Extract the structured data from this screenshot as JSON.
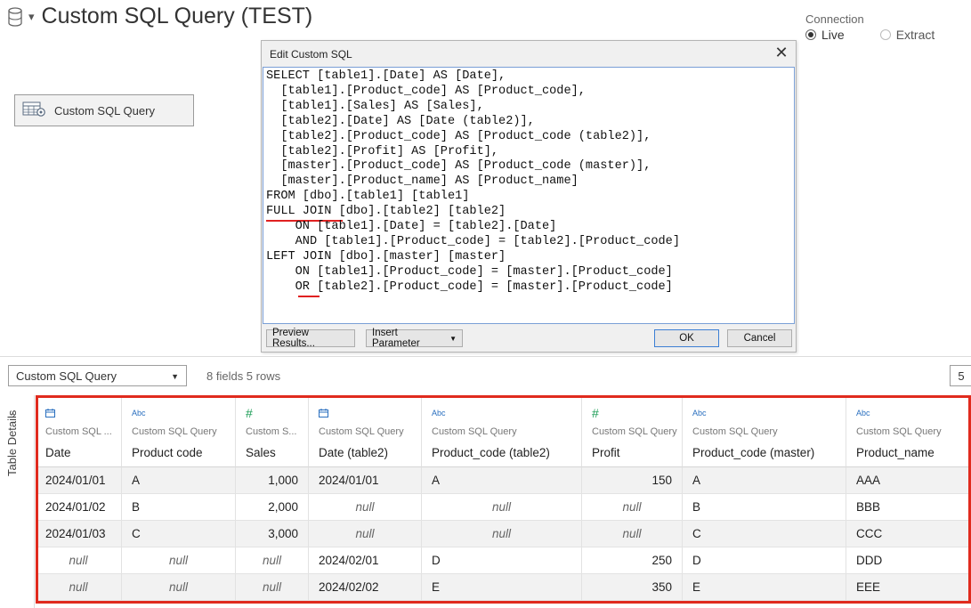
{
  "header": {
    "title": "Custom SQL Query (TEST)",
    "connection_label": "Connection",
    "live_label": "Live",
    "extract_label": "Extract"
  },
  "canvas": {
    "table_pill_label": "Custom SQL Query"
  },
  "dialog": {
    "title": "Edit Custom SQL",
    "close": "✕",
    "sql_lines": [
      "SELECT [table1].[Date] AS [Date],",
      "  [table1].[Product_code] AS [Product_code],",
      "  [table1].[Sales] AS [Sales],",
      "  [table2].[Date] AS [Date (table2)],",
      "  [table2].[Product_code] AS [Product_code (table2)],",
      "  [table2].[Profit] AS [Profit],",
      "  [master].[Product_code] AS [Product_code (master)],",
      "  [master].[Product_name] AS [Product_name]",
      "FROM [dbo].[table1] [table1]",
      "FULL JOIN [dbo].[table2] [table2]",
      "    ON [table1].[Date] = [table2].[Date]",
      "    AND [table1].[Product_code] = [table2].[Product_code]",
      "LEFT JOIN [dbo].[master] [master]",
      "    ON [table1].[Product_code] = [master].[Product_code]",
      "    OR [table2].[Product_code] = [master].[Product_code]"
    ],
    "preview_btn": "Preview Results...",
    "insert_param_btn": "Insert Parameter",
    "insert_param_caret": "▼",
    "ok_btn": "OK",
    "cancel_btn": "Cancel"
  },
  "toolbar": {
    "table_select": "Custom SQL Query",
    "select_caret": "▼",
    "fields_info": "8 fields 5 rows",
    "rows_value": "5"
  },
  "side": {
    "chevron": "›",
    "label": "Table Details"
  },
  "grid": {
    "columns": [
      {
        "type": "date",
        "icon": "calendar-icon",
        "source": "Custom SQL ...",
        "name": "Date"
      },
      {
        "type": "string",
        "icon": "Abc",
        "source": "Custom SQL Query",
        "name": "Product code"
      },
      {
        "type": "number",
        "icon": "#",
        "source": "Custom S...",
        "name": "Sales"
      },
      {
        "type": "date",
        "icon": "calendar-icon",
        "source": "Custom SQL Query",
        "name": "Date (table2)"
      },
      {
        "type": "string",
        "icon": "Abc",
        "source": "Custom SQL Query",
        "name": "Product_code (table2)"
      },
      {
        "type": "number",
        "icon": "#",
        "source": "Custom SQL Query",
        "name": "Profit"
      },
      {
        "type": "string",
        "icon": "Abc",
        "source": "Custom SQL Query",
        "name": "Product_code (master)"
      },
      {
        "type": "string",
        "icon": "Abc",
        "source": "Custom SQL Query",
        "name": "Product_name"
      }
    ],
    "rows": [
      [
        "2024/01/01",
        "A",
        "1,000",
        "2024/01/01",
        "A",
        "150",
        "A",
        "AAA"
      ],
      [
        "2024/01/02",
        "B",
        "2,000",
        "null",
        "null",
        "null",
        "B",
        "BBB"
      ],
      [
        "2024/01/03",
        "C",
        "3,000",
        "null",
        "null",
        "null",
        "C",
        "CCC"
      ],
      [
        "null",
        "null",
        "null",
        "2024/02/01",
        "D",
        "250",
        "D",
        "DDD"
      ],
      [
        "null",
        "null",
        "null",
        "2024/02/02",
        "E",
        "350",
        "E",
        "EEE"
      ]
    ]
  },
  "colors": {
    "highlight": "#e02b1e",
    "accent_blue": "#2a6fbf",
    "number_green": "#1d9d57"
  }
}
